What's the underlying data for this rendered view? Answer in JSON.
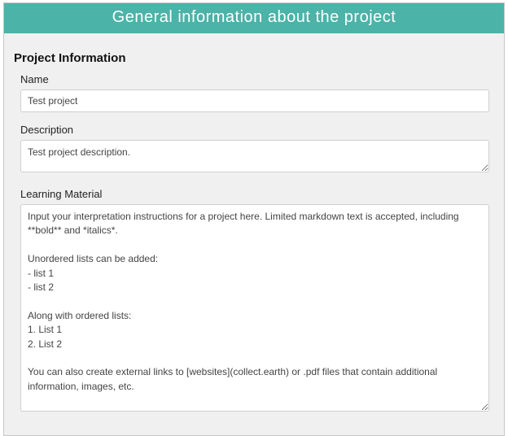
{
  "banner": {
    "title": "General information about the project"
  },
  "section": {
    "title": "Project Information"
  },
  "fields": {
    "name": {
      "label": "Name",
      "value": "Test project"
    },
    "description": {
      "label": "Description",
      "value": "Test project description."
    },
    "learning": {
      "label": "Learning Material",
      "value": "Input your interpretation instructions for a project here. Limited markdown text is accepted, including **bold** and *italics*.\n\nUnordered lists can be added:\n- list 1\n- list 2\n\nAlong with ordered lists:\n1. List 1\n2. List 2\n\nYou can also create external links to [websites](collect.earth) or .pdf files that contain additional information, images, etc."
    }
  }
}
